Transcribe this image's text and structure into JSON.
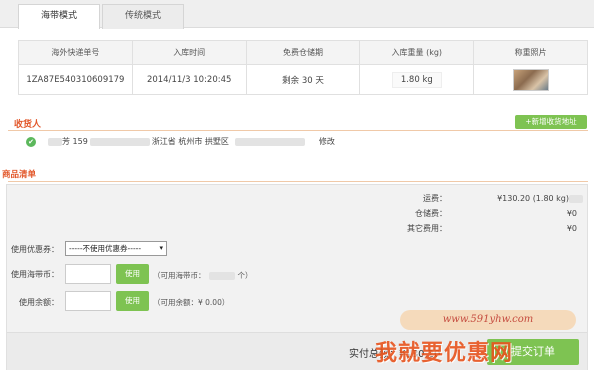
{
  "tabs": [
    {
      "label": "海带模式",
      "active": true
    },
    {
      "label": "传统模式",
      "active": false
    }
  ],
  "shipment_table": {
    "headers": [
      "海外快递单号",
      "入库时间",
      "免费仓储期",
      "入库重量 (kg)",
      "称重照片"
    ],
    "row": {
      "tracking_no": "1ZA87E540310609179",
      "inbound_time": "2014/11/3 10:20:45",
      "free_storage": "剩余 30 天",
      "weight": "1.80 kg"
    }
  },
  "recipient": {
    "title": "收货人",
    "add_address_label": "+新增收货地址",
    "name_partial": "芳 159",
    "address_partial": "浙江省 杭州市 拱墅区",
    "edit_label": "修改"
  },
  "goods": {
    "title": "商品清单",
    "fees": [
      {
        "label": "运费：",
        "value": "¥130.20 (1.80 kg)"
      },
      {
        "label": "仓储费：",
        "value": "¥0"
      },
      {
        "label": "其它费用：",
        "value": "¥0"
      }
    ],
    "coupon_label": "使用优惠券：",
    "coupon_selected": "-----不使用优惠券-----",
    "haidai_coin_label": "使用海带币：",
    "use_button": "使用",
    "coin_hint_prefix": "（可用海带币：",
    "coin_hint_suffix": "个）",
    "balance_label": "使用余额：",
    "balance_hint": "（可用余额：¥ 0.00）",
    "total_label": "实付总额：¥130.20",
    "submit_label": "提交订单"
  },
  "watermark": {
    "url": "www.591yhw.com",
    "text": "我就要优惠网"
  },
  "colors": {
    "accent_green": "#7ec352",
    "title_orange": "#e2572a"
  }
}
